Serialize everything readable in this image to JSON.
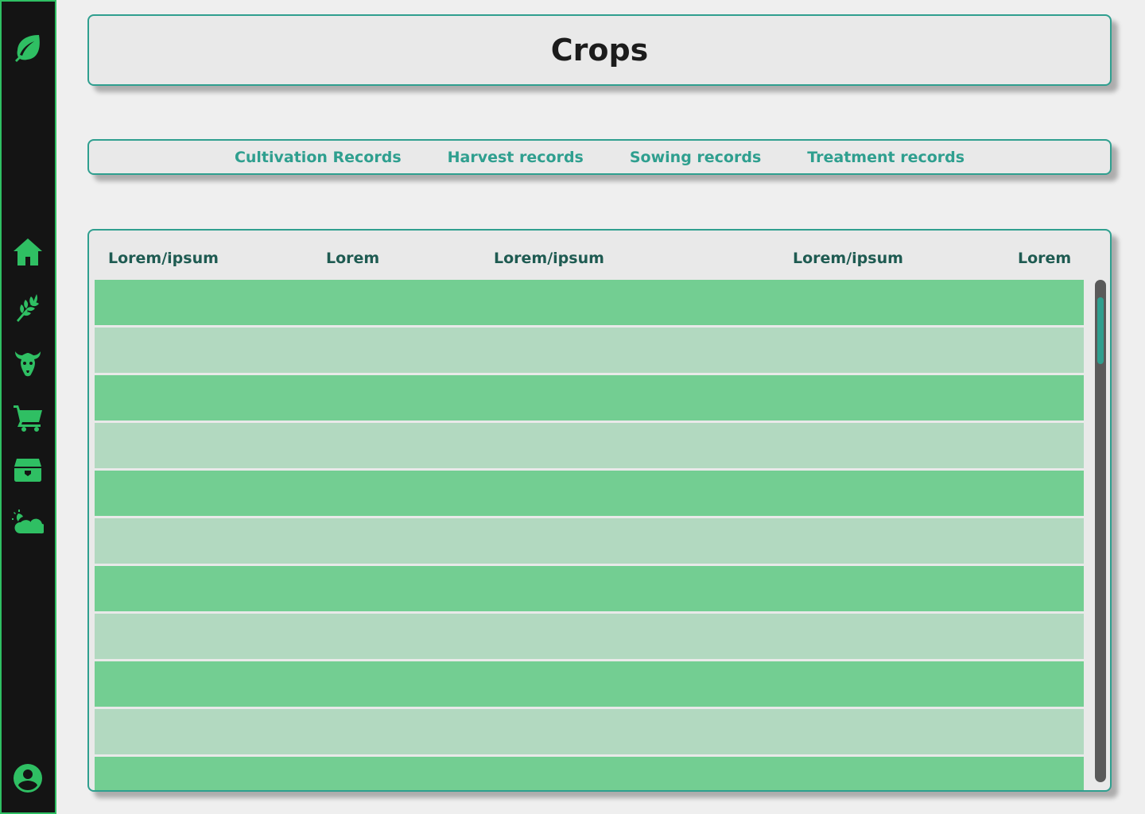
{
  "page": {
    "title": "Crops"
  },
  "colors": {
    "accent_green": "#2fbf63",
    "teal": "#2f9f8f",
    "row_dark": "#73ce92",
    "row_light": "#b2d9c0",
    "sidebar_bg": "#141414"
  },
  "sidebar": {
    "icons": [
      "leaf-icon",
      "home-icon",
      "wheat-icon",
      "cow-icon",
      "cart-icon",
      "storage-icon",
      "weather-icon",
      "user-icon"
    ]
  },
  "tabs": [
    {
      "label": "Cultivation Records"
    },
    {
      "label": "Harvest records"
    },
    {
      "label": "Sowing records"
    },
    {
      "label": "Treatment records"
    }
  ],
  "table": {
    "headers": [
      "Lorem/ipsum",
      "Lorem",
      "Lorem/ipsum",
      "Lorem/ipsum",
      "Lorem"
    ],
    "row_count": 11
  }
}
